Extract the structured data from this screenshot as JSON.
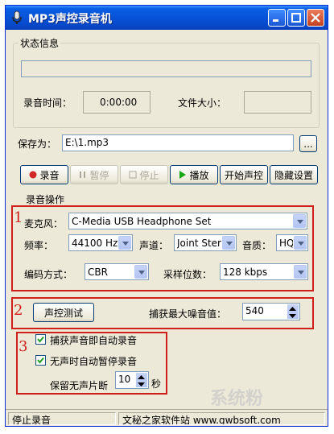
{
  "window": {
    "title": "MP3声控录音机"
  },
  "status_group": {
    "legend": "状态信息",
    "record_time_label": "录音时间：",
    "record_time_value": "0:00:00",
    "file_size_label": "文件大小：",
    "file_size_value": ""
  },
  "save": {
    "label": "保存为：",
    "path": "E:\\1.mp3",
    "browse_label": "..."
  },
  "toolbar": {
    "record": "录音",
    "pause": "暂停",
    "stop": "停止",
    "play": "播放",
    "start_voice": "开始声控",
    "hide_settings": "隐藏设置"
  },
  "record_ops": {
    "legend": "录音操作",
    "mic_label": "麦克风：",
    "mic_value": "C-Media USB Headphone Set",
    "freq_label": "频率：",
    "freq_value": "44100 Hz",
    "channel_label": "声道：",
    "channel_value": "Joint Ster",
    "quality_label": "音质：",
    "quality_value": "HQ",
    "encode_label": "编码方式：",
    "encode_value": "CBR",
    "bitrate_label": "采样位数：",
    "bitrate_value": "128 kbps"
  },
  "voice_test": {
    "button": "声控测试",
    "max_noise_label": "捕获最大噪音值：",
    "max_noise_value": "540"
  },
  "options": {
    "auto_record": "捕获声音即自动录音",
    "auto_pause": "无声时自动暂停录音",
    "keep_silence_label": "保留无声片断",
    "keep_silence_value": "10",
    "seconds_label": "秒"
  },
  "annotations": [
    "1",
    "2",
    "3"
  ],
  "statusbar": {
    "left": "停止录音",
    "right": "文秘之家软件站 www.gwbsoft.com"
  },
  "watermark": "系统粉",
  "colors": {
    "accent_red": "#d0201a",
    "title_blue": "#0852d8",
    "window_bg": "#ece9d8"
  }
}
